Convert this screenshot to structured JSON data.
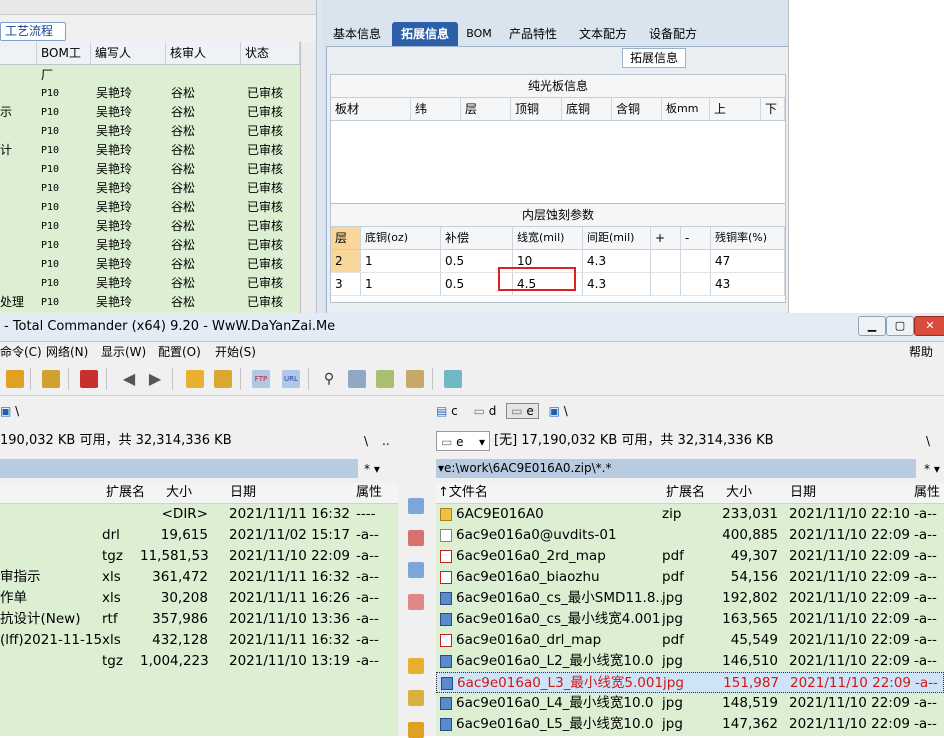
{
  "topleft": {
    "tab_label": "工艺流程",
    "headers": [
      "BOM工厂",
      "编写人",
      "核审人",
      "状态"
    ],
    "rows": [
      {
        "left": "",
        "factory": "P10",
        "writer": "吴艳玲",
        "reviewer": "谷松",
        "status": "已审核"
      },
      {
        "left": "示",
        "factory": "P10",
        "writer": "吴艳玲",
        "reviewer": "谷松",
        "status": "已审核"
      },
      {
        "left": "",
        "factory": "P10",
        "writer": "吴艳玲",
        "reviewer": "谷松",
        "status": "已审核"
      },
      {
        "left": "计",
        "factory": "P10",
        "writer": "吴艳玲",
        "reviewer": "谷松",
        "status": "已审核"
      },
      {
        "left": "",
        "factory": "P10",
        "writer": "吴艳玲",
        "reviewer": "谷松",
        "status": "已审核"
      },
      {
        "left": "",
        "factory": "P10",
        "writer": "吴艳玲",
        "reviewer": "谷松",
        "status": "已审核"
      },
      {
        "left": "",
        "factory": "P10",
        "writer": "吴艳玲",
        "reviewer": "谷松",
        "status": "已审核"
      },
      {
        "left": "",
        "factory": "P10",
        "writer": "吴艳玲",
        "reviewer": "谷松",
        "status": "已审核"
      },
      {
        "left": "",
        "factory": "P10",
        "writer": "吴艳玲",
        "reviewer": "谷松",
        "status": "已审核"
      },
      {
        "left": "",
        "factory": "P10",
        "writer": "吴艳玲",
        "reviewer": "谷松",
        "status": "已审核"
      },
      {
        "left": "",
        "factory": "P10",
        "writer": "吴艳玲",
        "reviewer": "谷松",
        "status": "已审核"
      },
      {
        "left": "处理",
        "factory": "P10",
        "writer": "吴艳玲",
        "reviewer": "谷松",
        "status": "已审核"
      }
    ]
  },
  "topright": {
    "tabs": [
      "基本信息",
      "拓展信息",
      "BOM",
      "产品特性",
      "文本配方",
      "设备配方"
    ],
    "active_tab": "拓展信息",
    "group_caption": "拓展信息",
    "section1": {
      "title": "纯光板信息",
      "headers": [
        "板材",
        "纬",
        "层",
        "顶铜",
        "底铜",
        "含铜",
        "板mm",
        "上",
        "下"
      ]
    },
    "section2": {
      "title": "内层蚀刻参数",
      "headers": [
        "层",
        "底铜(oz)",
        "补偿",
        "线宽(mil)",
        "间距(mil)",
        "+",
        "-",
        "残铜率(%)"
      ],
      "rows": [
        {
          "layer": "2",
          "base": "1",
          "comp": "0.5",
          "width": "10",
          "space": "4.3",
          "plus": "",
          "minus": "",
          "residual": "47"
        },
        {
          "layer": "3",
          "base": "1",
          "comp": "0.5",
          "width": "4.5",
          "space": "4.3",
          "plus": "",
          "minus": "",
          "residual": "43"
        }
      ]
    }
  },
  "tc": {
    "title": "- Total Commander (x64) 9.20 - WwW.DaYanZai.Me",
    "menu": [
      "命令(C)",
      "网络(N)",
      "显示(W)",
      "配置(O)",
      "开始(S)",
      "帮助(H)"
    ],
    "left": {
      "path_prefix": "\\",
      "free_text": "190,032 KB 可用，共 32,314,336 KB",
      "dir_btns": [
        "\\",
        ".."
      ],
      "filter": "*",
      "headers": [
        "扩展名",
        "大小",
        "日期",
        "属性"
      ],
      "files": [
        {
          "name": "",
          "ext": "",
          "size": "<DIR>",
          "date": "2021/11/11 16:32",
          "attr": "----"
        },
        {
          "name": "",
          "ext": "drl",
          "size": "19,615",
          "date": "2021/11/02 15:17",
          "attr": "-a--"
        },
        {
          "name": "",
          "ext": "tgz",
          "size": "11,581,537",
          "date": "2021/11/10 22:09",
          "attr": "-a--"
        },
        {
          "name": "审指示",
          "ext": "xls",
          "size": "361,472",
          "date": "2021/11/11 16:32",
          "attr": "-a--"
        },
        {
          "name": "作单",
          "ext": "xls",
          "size": "30,208",
          "date": "2021/11/11 16:26",
          "attr": "-a--"
        },
        {
          "name": "抗设计(New)",
          "ext": "rtf",
          "size": "357,986",
          "date": "2021/11/10 13:36",
          "attr": "-a--"
        },
        {
          "name": "(lff)2021-11-15",
          "ext": "xls",
          "size": "432,128",
          "date": "2021/11/11 16:32",
          "attr": "-a--"
        },
        {
          "name": "",
          "ext": "tgz",
          "size": "1,004,223",
          "date": "2021/11/10 13:19",
          "attr": "-a--"
        }
      ]
    },
    "right": {
      "drives": [
        "c",
        "d",
        "e"
      ],
      "active_drive": "e",
      "drive_combo": "e",
      "free_text": "[无]  17,190,032 KB 可用，共 32,314,336 KB",
      "dir_btns": [
        "\\"
      ],
      "path": "e:\\work\\6AC9E016A0.zip\\*.*",
      "filter": "*",
      "headers": [
        "文件名",
        "扩展名",
        "大小",
        "日期",
        "属性"
      ],
      "files": [
        {
          "name": "6AC9E016A0",
          "ext": "zip",
          "size": "233,031",
          "date": "2021/11/10 22:10",
          "attr": "-a--",
          "icon": "zip"
        },
        {
          "name": "6ac9e016a0@uvdits-01",
          "ext": "",
          "size": "400,885",
          "date": "2021/11/10 22:09",
          "attr": "-a--",
          "icon": "blank"
        },
        {
          "name": "6ac9e016a0_2rd_map",
          "ext": "pdf",
          "size": "49,307",
          "date": "2021/11/10 22:09",
          "attr": "-a--",
          "icon": "pdf"
        },
        {
          "name": "6ac9e016a0_biaozhu",
          "ext": "pdf",
          "size": "54,156",
          "date": "2021/11/10 22:09",
          "attr": "-a--",
          "icon": "pdf"
        },
        {
          "name": "6ac9e016a0_cs_最小SMD11.8..",
          "ext": "jpg",
          "size": "192,802",
          "date": "2021/11/10 22:09",
          "attr": "-a--",
          "icon": "img"
        },
        {
          "name": "6ac9e016a0_cs_最小线宽4.001",
          "ext": "jpg",
          "size": "163,565",
          "date": "2021/11/10 22:09",
          "attr": "-a--",
          "icon": "img"
        },
        {
          "name": "6ac9e016a0_drl_map",
          "ext": "pdf",
          "size": "45,549",
          "date": "2021/11/10 22:09",
          "attr": "-a--",
          "icon": "pdf"
        },
        {
          "name": "6ac9e016a0_L2_最小线宽10.0",
          "ext": "jpg",
          "size": "146,510",
          "date": "2021/11/10 22:09",
          "attr": "-a--",
          "icon": "img"
        },
        {
          "name": "6ac9e016a0_L3_最小线宽5.001",
          "ext": "jpg",
          "size": "151,987",
          "date": "2021/11/10 22:09",
          "attr": "-a--",
          "icon": "img",
          "selected": true
        },
        {
          "name": "6ac9e016a0_L4_最小线宽10.0",
          "ext": "jpg",
          "size": "148,519",
          "date": "2021/11/10 22:09",
          "attr": "-a--",
          "icon": "img"
        },
        {
          "name": "6ac9e016a0_L5_最小线宽10.0",
          "ext": "jpg",
          "size": "147,362",
          "date": "2021/11/10 22:09",
          "attr": "-a--",
          "icon": "img"
        }
      ]
    },
    "colors": {
      "list_bg": "#dcefd2",
      "path_bg": "#b8cbe0",
      "selected_text": "#d01818",
      "active_tab": "#2c5fa8"
    }
  }
}
